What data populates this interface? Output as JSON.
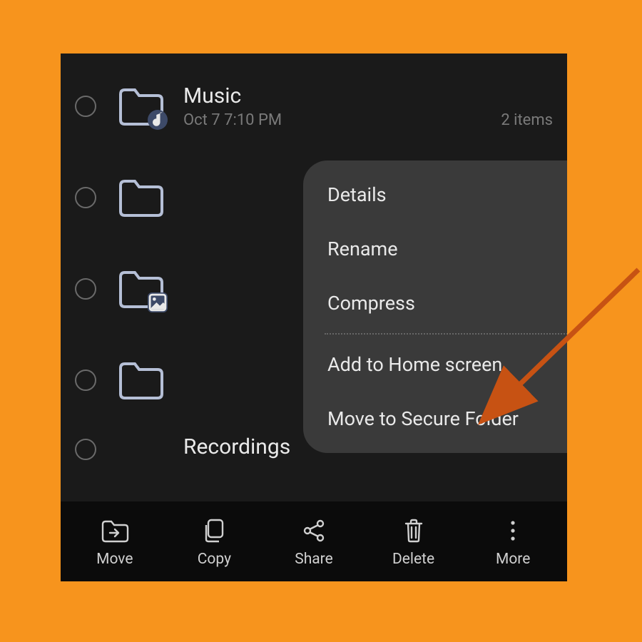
{
  "files": {
    "item0": {
      "name": "Music",
      "date": "Oct 7 7:10 PM",
      "count": "2 items",
      "folder_type": "music"
    },
    "item1": {
      "folder_type": "plain"
    },
    "item2": {
      "folder_type": "picture"
    },
    "item3": {
      "folder_type": "plain"
    },
    "partial_name": "Recordings"
  },
  "menu": {
    "details": "Details",
    "rename": "Rename",
    "compress": "Compress",
    "add_home": "Add to Home screen",
    "secure": "Move to Secure Folder"
  },
  "bottom": {
    "move": "Move",
    "copy": "Copy",
    "share": "Share",
    "delete": "Delete",
    "more": "More"
  },
  "colors": {
    "background": "#f7941d",
    "arrow": "#d35400"
  }
}
